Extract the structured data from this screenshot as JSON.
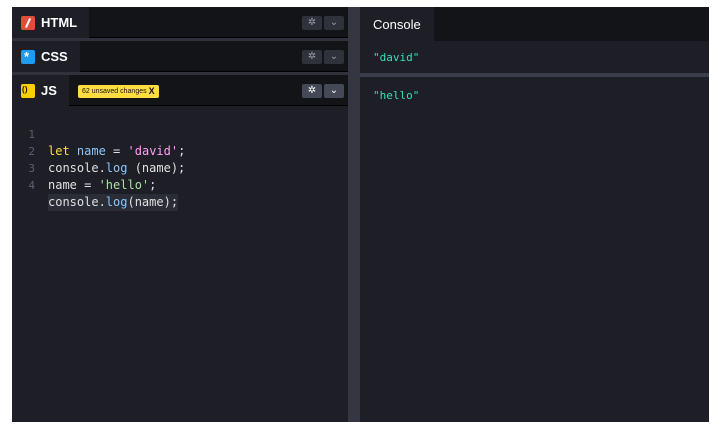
{
  "editor": {
    "panels": [
      {
        "label": "HTML"
      },
      {
        "label": "CSS"
      },
      {
        "label": "JS"
      }
    ],
    "unsaved_badge": "62 unsaved changes",
    "badge_close": "X",
    "settings_glyph": "✲",
    "collapse_glyph": "⌄",
    "code_lines": [
      {
        "num": "1"
      },
      {
        "num": "2"
      },
      {
        "num": "3"
      },
      {
        "num": "4"
      }
    ],
    "tokens": {
      "l1_kw": "let",
      "l1_var": "name",
      "l1_eq": " = ",
      "l1_str": "'david'",
      "l1_end": ";",
      "l2_a": "console.",
      "l2_b": "log",
      "l2_c": " (name);",
      "l3_a": "name = ",
      "l3_str": "'hello'",
      "l3_end": ";",
      "l4_a": "console.",
      "l4_b": "log",
      "l4_c": "(name);"
    }
  },
  "console": {
    "tab_label": "Console",
    "logs": [
      "\"david\"",
      "\"hello\""
    ]
  },
  "colors": {
    "html_icon": "#e44d3a",
    "css_icon": "#1f9cf0",
    "js_icon": "#fcd000",
    "badge_bg": "#ffdd40",
    "console_text": "#3ddcb9"
  }
}
